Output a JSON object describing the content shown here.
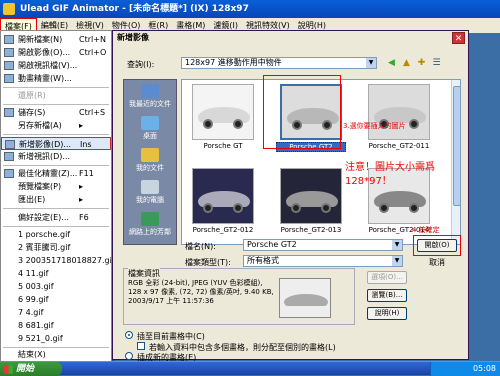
{
  "window": {
    "title": "Ulead GIF Animator - [未命名標題*] (IX) 128x97"
  },
  "menubar": [
    "檔案(F)",
    "編輯(E)",
    "檢視(V)",
    "物件(O)",
    "框(R)",
    "畫格(M)",
    "濾鏡(I)",
    "視訊特效(V)",
    "說明(H)"
  ],
  "file_menu": {
    "items": [
      {
        "label": "開新檔案(N)",
        "shortcut": "Ctrl+N"
      },
      {
        "label": "開啟影像(O)...",
        "shortcut": "Ctrl+O"
      },
      {
        "label": "開啟視訊檔(V)...",
        "shortcut": ""
      },
      {
        "label": "動畫精靈(W)...",
        "shortcut": ""
      },
      {
        "label": "還原(R)",
        "shortcut": ""
      },
      {
        "label": "儲存(S)",
        "shortcut": "Ctrl+S"
      },
      {
        "label": "另存新檔(A)",
        "shortcut": "▸"
      },
      {
        "label": "新增影像(D)...",
        "shortcut": "Ins"
      },
      {
        "label": "新增視訊(D)...",
        "shortcut": ""
      },
      {
        "label": "最佳化精靈(Z)...",
        "shortcut": "F11"
      },
      {
        "label": "預覽檔案(P)",
        "shortcut": "▸"
      },
      {
        "label": "匯出(E)",
        "shortcut": "▸"
      },
      {
        "label": "偏好設定(E)...",
        "shortcut": "F6"
      },
      {
        "label": "結束(X)",
        "shortcut": ""
      }
    ],
    "recent": [
      "1 porsche.gif",
      "2 賓菲騰司.gif",
      "3 200351718018827.gif",
      "4 11.gif",
      "5 003.gif",
      "6 99.gif",
      "7 4.gif",
      "8 681.gif",
      "9 521_0.gif"
    ]
  },
  "dialog": {
    "title": "新增影像",
    "lookin_label": "查詢(I):",
    "lookin_value": "128x97 進移動作用中物件",
    "places": [
      "我最近的文件",
      "桌面",
      "我的文件",
      "我的電腦",
      "網路上的芳鄰"
    ],
    "files": [
      {
        "name": "Porsche GT",
        "selected": false
      },
      {
        "name": "Porsche GT2",
        "selected": true
      },
      {
        "name": "Porsche_GT2-011",
        "selected": false
      },
      {
        "name": "Porsche_GT2-012",
        "selected": false
      },
      {
        "name": "Porsche_GT2-013",
        "selected": false
      },
      {
        "name": "Porsche_GT2-014",
        "selected": false
      }
    ],
    "filename_label": "檔名(N):",
    "filename_value": "Porsche GT2",
    "filetype_label": "檔案類型(T):",
    "filetype_value": "所有格式",
    "open_button": "開啟(O)",
    "cancel_button": "取消",
    "info_title": "檔案資訊",
    "info_text": "RGB 全彩 (24-bit), JPEG (YUV 色彩模組), 128 x 97 像素, (72, 72) 像素/英吋, 9.40 KB, 2003/9/17 上午 11:57:36",
    "options_button": "選項(O)...",
    "browse_button": "瀏覽(B)...",
    "help_button": "說明(H)",
    "radio_insert": "插至目前畫格中(C)",
    "checkbox_layers": "若輸入資料中包含多個畫格，則分配至個別的畫格(L)",
    "radio_after": "插成新的畫格(E)"
  },
  "annotations": {
    "step3": "3.選你要插入的圖片",
    "warning_line1": "注意！圖片大小需爲",
    "warning_line2": "128*97！",
    "step4": "4.按確定"
  },
  "taskbar": {
    "start_label": "開始",
    "clock": "05:08"
  }
}
